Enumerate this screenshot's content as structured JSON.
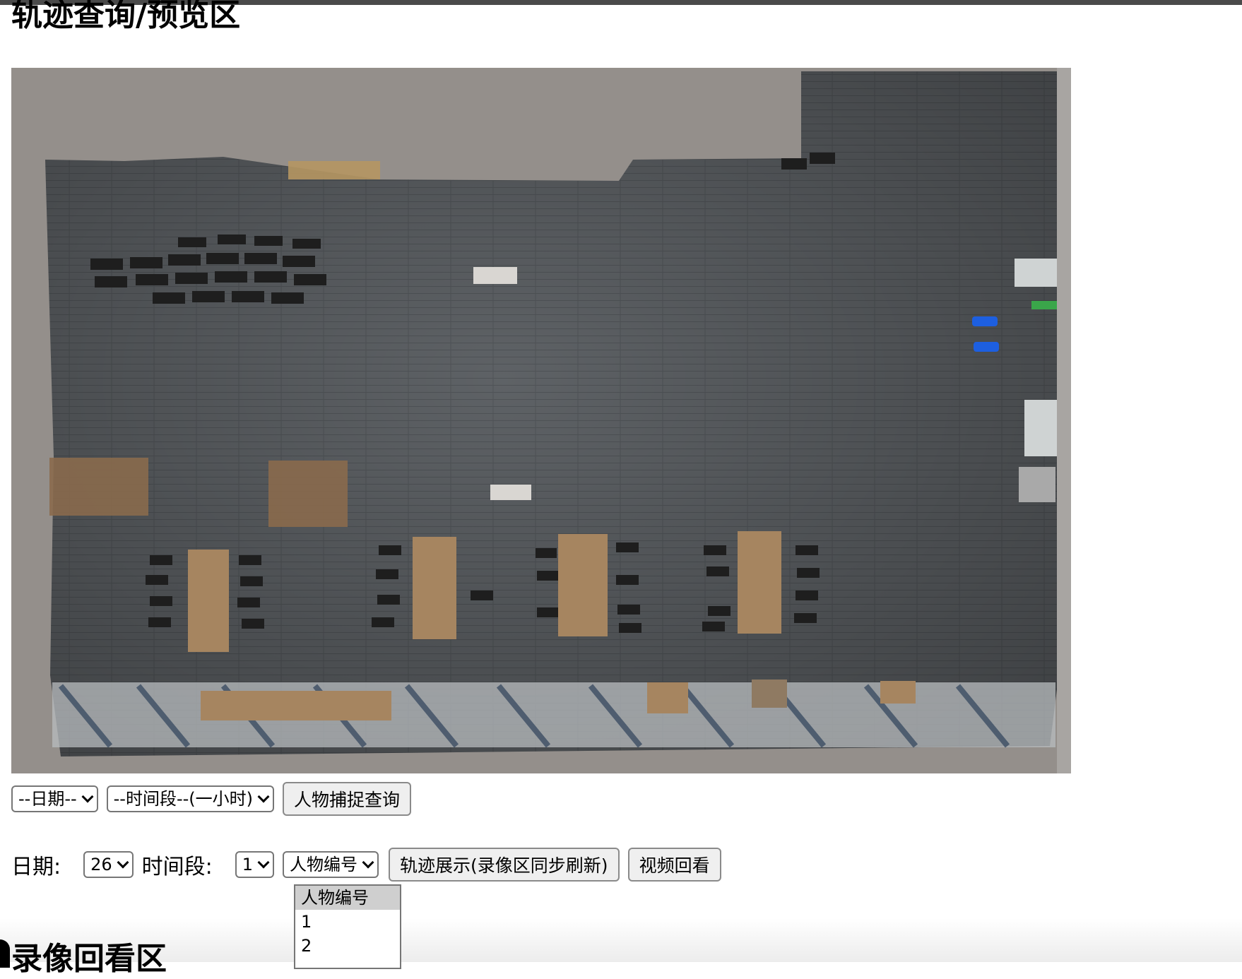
{
  "page": {
    "title": "轨迹查询/预览区",
    "section2_title": "录像回看区"
  },
  "query_bar": {
    "date_select": "--日期--",
    "timeslot_select": "--时间段--(一小时)",
    "capture_button": "人物捕捉查询"
  },
  "track_bar": {
    "date_label": "日期:",
    "date_value": "26",
    "timeslot_label": "时间段:",
    "timeslot_value": "1",
    "person_select": "人物编号",
    "track_button": "轨迹展示(录像区同步刷新)",
    "replay_button": "视频回看"
  },
  "person_dropdown": {
    "options": [
      "人物编号",
      "1",
      "2"
    ],
    "selected_index": 0
  },
  "colors": {
    "map_background": "#948f8b",
    "floor": "#5f6266",
    "desk": "#a68560",
    "chair": "#1e1e1e",
    "accent_blue": "#1d5fe0"
  }
}
